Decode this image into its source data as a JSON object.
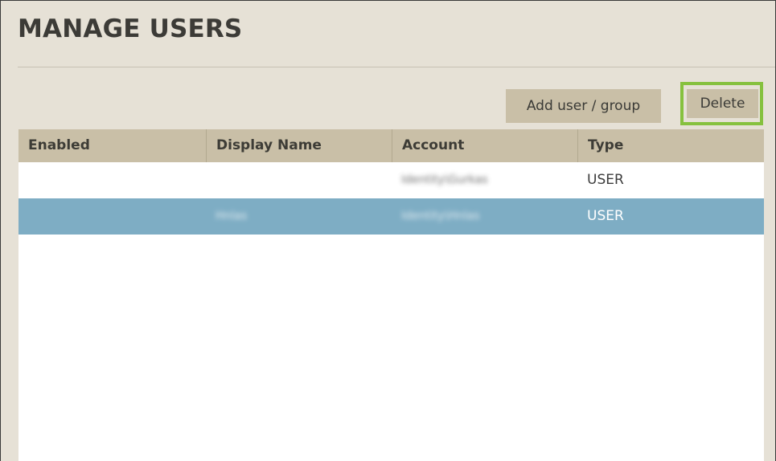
{
  "page": {
    "title": "MANAGE USERS"
  },
  "toolbar": {
    "add_label": "Add user / group",
    "delete_label": "Delete"
  },
  "table": {
    "columns": [
      "Enabled",
      "Display Name",
      "Account",
      "Type"
    ],
    "rows": [
      {
        "enabled": "",
        "display_name": "",
        "account": "Identity\\Gurkas",
        "type": "USER",
        "selected": false
      },
      {
        "enabled": "",
        "display_name": "Hnlas",
        "account": "Identity\\Hnlas",
        "type": "USER",
        "selected": true
      }
    ]
  },
  "colors": {
    "background": "#e6e1d6",
    "header": "#c9bfa7",
    "button": "#c9bfa7",
    "highlight_outline": "#86c13e",
    "selected_row": "#7eadc4"
  }
}
